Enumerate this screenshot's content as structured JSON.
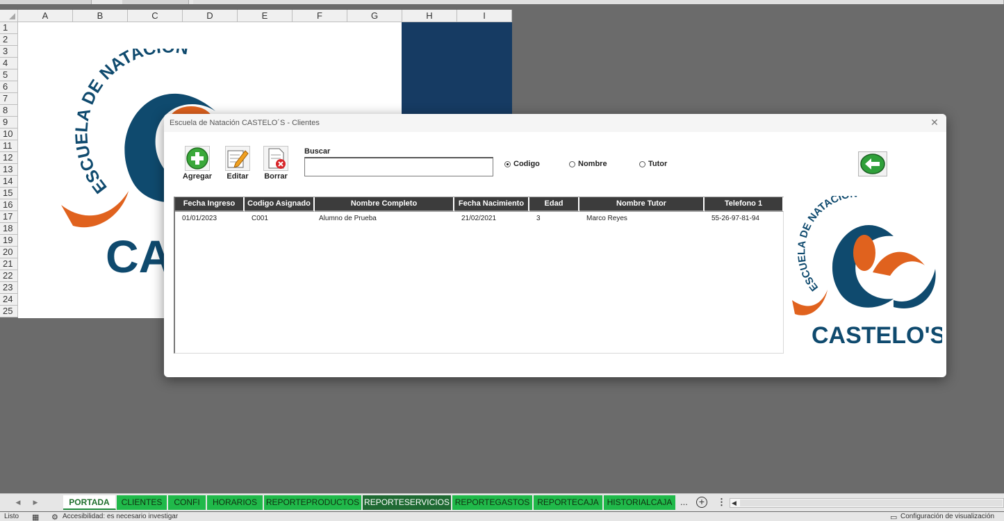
{
  "sheet": {
    "columns": [
      "A",
      "B",
      "C",
      "D",
      "E",
      "F",
      "G",
      "H",
      "I"
    ],
    "rows": [
      "1",
      "2",
      "3",
      "4",
      "5",
      "6",
      "7",
      "8",
      "9",
      "10",
      "11",
      "12",
      "13",
      "14",
      "15",
      "16",
      "17",
      "18",
      "19",
      "20",
      "21",
      "22",
      "23",
      "24",
      "25"
    ],
    "logo_top_text": "ESCUELA DE NATACIÓN",
    "logo_bottom_text": "CA",
    "colors": {
      "navy": "#163b63",
      "orange": "#e0621e",
      "logo_blue": "#0f4a6e"
    }
  },
  "dialog": {
    "title": "Escuela de Natación CASTELO´S - Clientes",
    "toolbar": {
      "add_label": "Agregar",
      "edit_label": "Editar",
      "delete_label": "Borrar"
    },
    "search": {
      "label": "Buscar",
      "value": ""
    },
    "search_by": {
      "options": [
        {
          "label": "Codigo",
          "selected": true
        },
        {
          "label": "Nombre",
          "selected": false
        },
        {
          "label": "Tutor",
          "selected": false
        }
      ]
    },
    "table": {
      "columns": [
        "Fecha Ingreso",
        "Codigo Asignado",
        "Nombre Completo",
        "Fecha Nacimiento",
        "Edad",
        "Nombre Tutor",
        "Telefono 1"
      ],
      "rows": [
        [
          "01/01/2023",
          "C001",
          "Alumno de Prueba",
          "21/02/2021",
          "3",
          "Marco Reyes",
          "55-26-97-81-94"
        ]
      ]
    },
    "logo": {
      "top_text": "ESCUELA DE NATACIÓN",
      "bottom_text": "CASTELO'S"
    }
  },
  "tabs": {
    "items": [
      {
        "label": "PORTADA",
        "state": "active"
      },
      {
        "label": "CLIENTES",
        "state": "normal"
      },
      {
        "label": "CONFI",
        "state": "normal"
      },
      {
        "label": "HORARIOS",
        "state": "normal"
      },
      {
        "label": "REPORTEPRODUCTOS",
        "state": "normal"
      },
      {
        "label": "REPORTESERVICIOS",
        "state": "dark"
      },
      {
        "label": "REPORTEGASTOS",
        "state": "normal"
      },
      {
        "label": "REPORTECAJA",
        "state": "normal"
      },
      {
        "label": "HISTORIALCAJA",
        "state": "normal"
      }
    ],
    "more_label": "..."
  },
  "status": {
    "ready": "Listo",
    "accessibility": "Accesibilidad: es necesario investigar",
    "display_settings": "Configuración de visualización"
  }
}
